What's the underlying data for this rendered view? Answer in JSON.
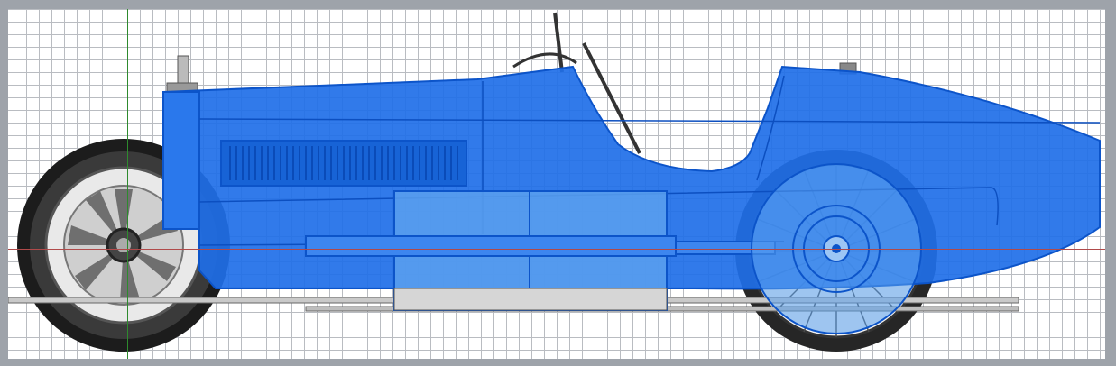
{
  "viewport": {
    "view": "side",
    "grid": true,
    "axis_colors": {
      "vertical": "#2e8a2e",
      "horizontal": "#b04a4a"
    }
  },
  "model": {
    "colors": {
      "body_fill": "#1f6fe8",
      "body_edge": "#0c54c9",
      "panel_fill": "#5aa0ee",
      "wheel_dark": "#1a1a1a",
      "wheel_mid": "#7a7a7a",
      "chrome": "#d8d8d8"
    }
  }
}
